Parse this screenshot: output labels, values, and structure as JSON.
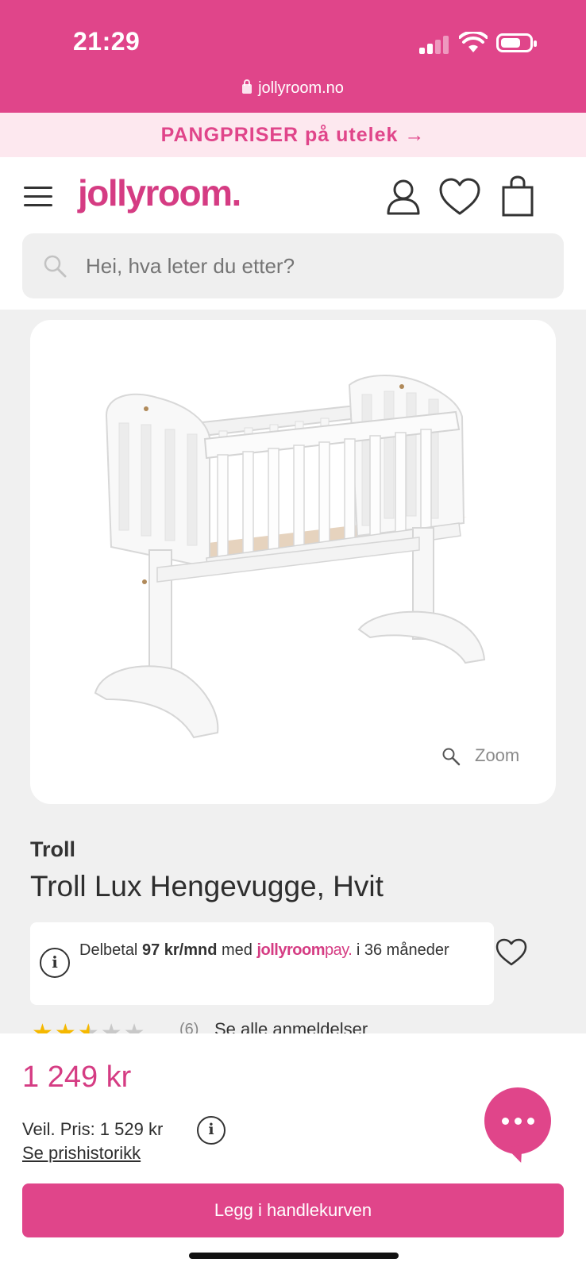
{
  "status_bar": {
    "time": "21:29",
    "url": "jollyroom.no"
  },
  "promo": {
    "text": "PANGPRISER på utelek →"
  },
  "header": {
    "logo": "jollyroom.",
    "search_placeholder": "Hei, hva leter du etter?",
    "icons": [
      "menu-icon",
      "user-icon",
      "heart-icon",
      "bag-icon"
    ]
  },
  "product": {
    "zoom_label": "Zoom",
    "brand": "Troll",
    "title": "Troll Lux Hengevugge, Hvit",
    "rating": {
      "stars_filled": 2.5,
      "stars_total": 5,
      "count": "(6)",
      "link": "Se alle anmeldelser"
    }
  },
  "payment": {
    "prefix": "Delbetal",
    "amount": "97 kr/mnd",
    "with": "med",
    "brand_main": "jollyroom",
    "brand_pay": "pay.",
    "suffix": "i 36 måneder"
  },
  "bottom": {
    "price": "1 249 kr",
    "rrp": "Veil. Pris: 1 529 kr",
    "history_link": "Se prishistorikk",
    "cta": "Legg i handlekurven"
  },
  "colors": {
    "brand_pink": "#e0458a",
    "promo_bg": "#fde8ef",
    "star": "#f5b800"
  }
}
